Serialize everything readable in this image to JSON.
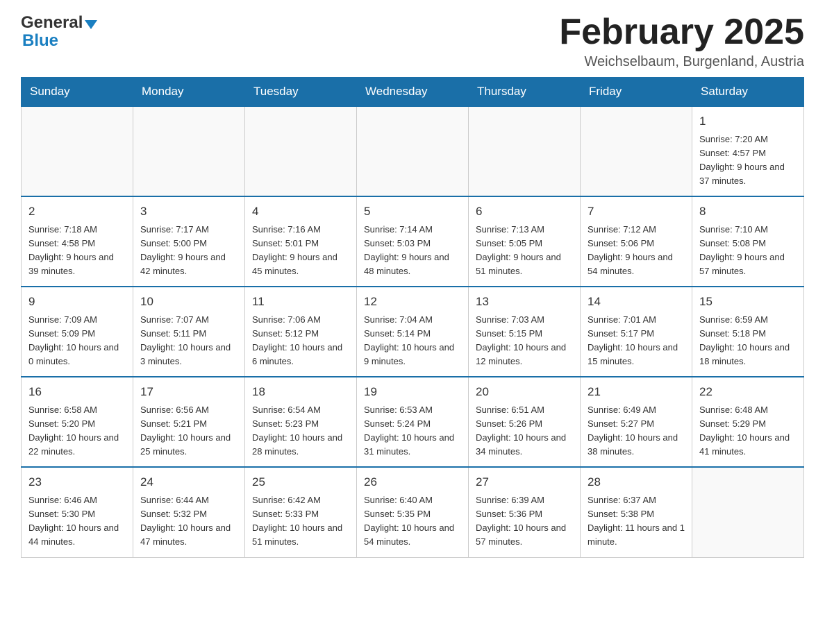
{
  "header": {
    "month_title": "February 2025",
    "location": "Weichselbaum, Burgenland, Austria",
    "logo_general": "General",
    "logo_blue": "Blue"
  },
  "weekdays": [
    "Sunday",
    "Monday",
    "Tuesday",
    "Wednesday",
    "Thursday",
    "Friday",
    "Saturday"
  ],
  "weeks": [
    {
      "days": [
        {
          "num": "",
          "info": ""
        },
        {
          "num": "",
          "info": ""
        },
        {
          "num": "",
          "info": ""
        },
        {
          "num": "",
          "info": ""
        },
        {
          "num": "",
          "info": ""
        },
        {
          "num": "",
          "info": ""
        },
        {
          "num": "1",
          "info": "Sunrise: 7:20 AM\nSunset: 4:57 PM\nDaylight: 9 hours and 37 minutes."
        }
      ]
    },
    {
      "days": [
        {
          "num": "2",
          "info": "Sunrise: 7:18 AM\nSunset: 4:58 PM\nDaylight: 9 hours and 39 minutes."
        },
        {
          "num": "3",
          "info": "Sunrise: 7:17 AM\nSunset: 5:00 PM\nDaylight: 9 hours and 42 minutes."
        },
        {
          "num": "4",
          "info": "Sunrise: 7:16 AM\nSunset: 5:01 PM\nDaylight: 9 hours and 45 minutes."
        },
        {
          "num": "5",
          "info": "Sunrise: 7:14 AM\nSunset: 5:03 PM\nDaylight: 9 hours and 48 minutes."
        },
        {
          "num": "6",
          "info": "Sunrise: 7:13 AM\nSunset: 5:05 PM\nDaylight: 9 hours and 51 minutes."
        },
        {
          "num": "7",
          "info": "Sunrise: 7:12 AM\nSunset: 5:06 PM\nDaylight: 9 hours and 54 minutes."
        },
        {
          "num": "8",
          "info": "Sunrise: 7:10 AM\nSunset: 5:08 PM\nDaylight: 9 hours and 57 minutes."
        }
      ]
    },
    {
      "days": [
        {
          "num": "9",
          "info": "Sunrise: 7:09 AM\nSunset: 5:09 PM\nDaylight: 10 hours and 0 minutes."
        },
        {
          "num": "10",
          "info": "Sunrise: 7:07 AM\nSunset: 5:11 PM\nDaylight: 10 hours and 3 minutes."
        },
        {
          "num": "11",
          "info": "Sunrise: 7:06 AM\nSunset: 5:12 PM\nDaylight: 10 hours and 6 minutes."
        },
        {
          "num": "12",
          "info": "Sunrise: 7:04 AM\nSunset: 5:14 PM\nDaylight: 10 hours and 9 minutes."
        },
        {
          "num": "13",
          "info": "Sunrise: 7:03 AM\nSunset: 5:15 PM\nDaylight: 10 hours and 12 minutes."
        },
        {
          "num": "14",
          "info": "Sunrise: 7:01 AM\nSunset: 5:17 PM\nDaylight: 10 hours and 15 minutes."
        },
        {
          "num": "15",
          "info": "Sunrise: 6:59 AM\nSunset: 5:18 PM\nDaylight: 10 hours and 18 minutes."
        }
      ]
    },
    {
      "days": [
        {
          "num": "16",
          "info": "Sunrise: 6:58 AM\nSunset: 5:20 PM\nDaylight: 10 hours and 22 minutes."
        },
        {
          "num": "17",
          "info": "Sunrise: 6:56 AM\nSunset: 5:21 PM\nDaylight: 10 hours and 25 minutes."
        },
        {
          "num": "18",
          "info": "Sunrise: 6:54 AM\nSunset: 5:23 PM\nDaylight: 10 hours and 28 minutes."
        },
        {
          "num": "19",
          "info": "Sunrise: 6:53 AM\nSunset: 5:24 PM\nDaylight: 10 hours and 31 minutes."
        },
        {
          "num": "20",
          "info": "Sunrise: 6:51 AM\nSunset: 5:26 PM\nDaylight: 10 hours and 34 minutes."
        },
        {
          "num": "21",
          "info": "Sunrise: 6:49 AM\nSunset: 5:27 PM\nDaylight: 10 hours and 38 minutes."
        },
        {
          "num": "22",
          "info": "Sunrise: 6:48 AM\nSunset: 5:29 PM\nDaylight: 10 hours and 41 minutes."
        }
      ]
    },
    {
      "days": [
        {
          "num": "23",
          "info": "Sunrise: 6:46 AM\nSunset: 5:30 PM\nDaylight: 10 hours and 44 minutes."
        },
        {
          "num": "24",
          "info": "Sunrise: 6:44 AM\nSunset: 5:32 PM\nDaylight: 10 hours and 47 minutes."
        },
        {
          "num": "25",
          "info": "Sunrise: 6:42 AM\nSunset: 5:33 PM\nDaylight: 10 hours and 51 minutes."
        },
        {
          "num": "26",
          "info": "Sunrise: 6:40 AM\nSunset: 5:35 PM\nDaylight: 10 hours and 54 minutes."
        },
        {
          "num": "27",
          "info": "Sunrise: 6:39 AM\nSunset: 5:36 PM\nDaylight: 10 hours and 57 minutes."
        },
        {
          "num": "28",
          "info": "Sunrise: 6:37 AM\nSunset: 5:38 PM\nDaylight: 11 hours and 1 minute."
        },
        {
          "num": "",
          "info": ""
        }
      ]
    }
  ]
}
